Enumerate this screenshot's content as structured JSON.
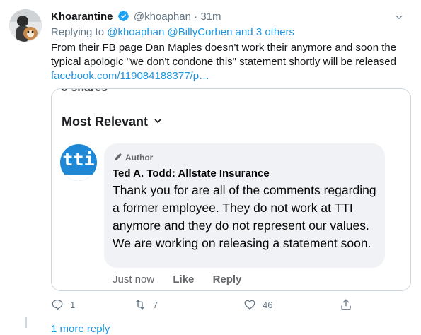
{
  "tweet": {
    "display_name": "Khoarantine",
    "handle": "@khoaphan",
    "separator": "·",
    "time": "31m",
    "replying_prefix": "Replying to",
    "replying_users": "@khoaphan @BillyCorben",
    "replying_conj": "and",
    "replying_others": "3 others",
    "text": "From their FB page Dan Maples doesn't work their anymore and soon the typical apologic \"we don't condone this\" statement shortly will be released",
    "link_text": "facebook.com/119084188377/p…"
  },
  "card": {
    "cut_text": "J shares",
    "sort_label": "Most Relevant",
    "page_avatar_text": "tti",
    "author_badge": "Author",
    "commenter": "Ted A. Todd: Allstate Insurance",
    "comment": "Thank you for are all of the comments regarding a former employee. They do not work at TTI anymore and they do not represent our values. We are working on releasing a statement soon.",
    "actions": {
      "time": "Just now",
      "like": "Like",
      "reply": "Reply"
    }
  },
  "tweet_actions": {
    "replies": "1",
    "retweets": "7",
    "likes": "46"
  },
  "more_replies": "1 more reply",
  "colors": {
    "link": "#1b95e0",
    "verified": "#1da1f2",
    "muted": "#657786",
    "tti_blue": "#1e88d6"
  }
}
